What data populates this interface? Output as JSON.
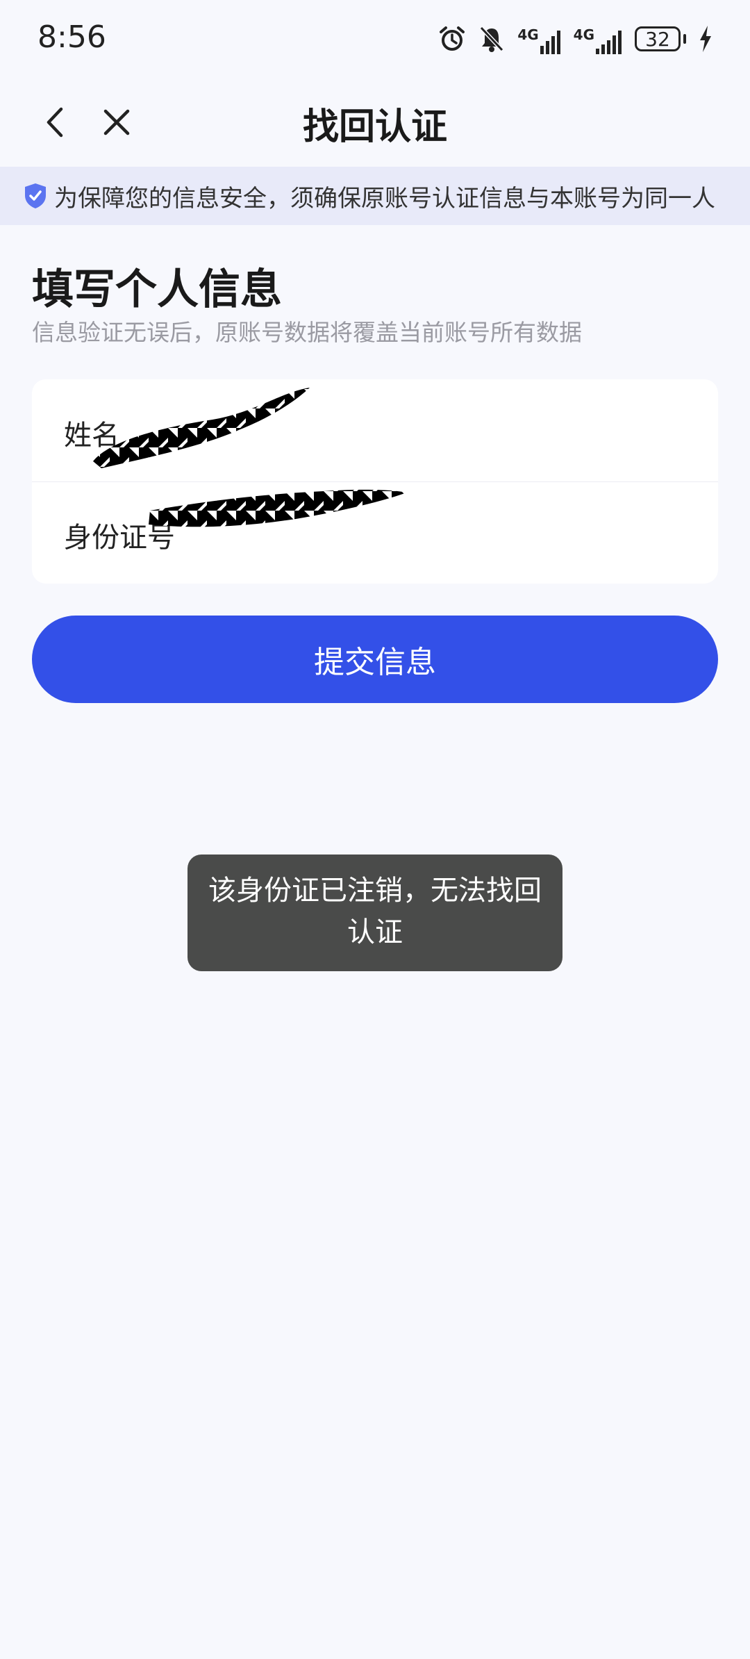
{
  "status_bar": {
    "time": "8:56",
    "icons": [
      "alarm-icon",
      "mute-bell-icon",
      "signal-4g-icon",
      "signal-4g-icon",
      "battery-icon",
      "charging-icon"
    ],
    "network_label_1": "4G",
    "network_label_2": "4G",
    "battery_level": "32"
  },
  "navbar": {
    "title": "找回认证",
    "back_icon": "chevron-left-icon",
    "close_icon": "close-icon"
  },
  "notice": {
    "icon": "shield-check-icon",
    "text": "为保障您的信息安全，须确保原账号认证信息与本账号为同一人"
  },
  "form": {
    "heading": "填写个人信息",
    "subheading": "信息验证无误后，原账号数据将覆盖当前账号所有数据",
    "fields": [
      {
        "label": "姓名"
      },
      {
        "label": "身份证号"
      }
    ]
  },
  "submit_label": "提交信息",
  "toast": {
    "message": "该身份证已注销，无法找回认证"
  },
  "colors": {
    "accent": "#3350e8",
    "background": "#f7f8fd",
    "notice_bg": "#e8eaf9",
    "toast_bg": "#4a4b4a"
  }
}
